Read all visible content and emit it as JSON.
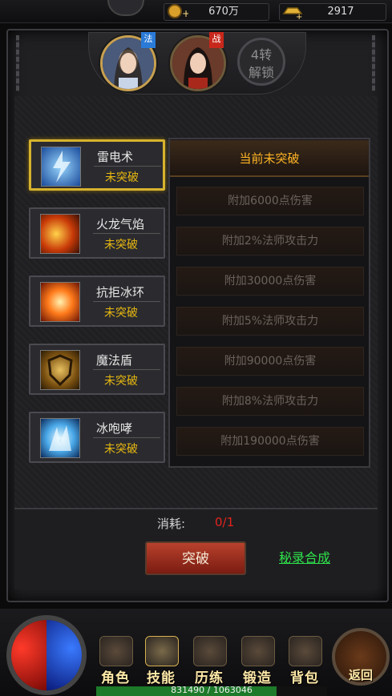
{
  "currency": {
    "gold": {
      "icon": "gold-coin-icon",
      "value": "670万"
    },
    "ingot": {
      "icon": "gold-ingot-icon",
      "value": "2917"
    }
  },
  "portraits": [
    {
      "name": "mage-portrait",
      "badge": "法",
      "badge_color": "#2a7ad8"
    },
    {
      "name": "warrior-portrait",
      "badge": "战",
      "badge_color": "#c8281c"
    }
  ],
  "locked_slot": {
    "line1": "4转",
    "line2": "解锁"
  },
  "skills": [
    {
      "name": "雷电术",
      "status": "未突破",
      "icon": "lightning-skill-icon",
      "selected": true
    },
    {
      "name": "火龙气焰",
      "status": "未突破",
      "icon": "fire-dragon-skill-icon",
      "selected": false
    },
    {
      "name": "抗拒冰环",
      "status": "未突破",
      "icon": "repel-ring-skill-icon",
      "selected": false
    },
    {
      "name": "魔法盾",
      "status": "未突破",
      "icon": "magic-shield-skill-icon",
      "selected": false
    },
    {
      "name": "冰咆哮",
      "status": "未突破",
      "icon": "ice-roar-skill-icon",
      "selected": false
    }
  ],
  "panel": {
    "title": "当前未突破",
    "effects": [
      "附加6000点伤害",
      "附加2%法师攻击力",
      "附加30000点伤害",
      "附加5%法师攻击力",
      "附加90000点伤害",
      "附加8%法师攻击力",
      "附加190000点伤害"
    ]
  },
  "cost": {
    "label": "消耗:",
    "value": "0/1"
  },
  "break_button": "突破",
  "synth_link": "秘录合成",
  "nav": [
    {
      "label": "角色",
      "icon": "character-icon"
    },
    {
      "label": "技能",
      "icon": "skill-book-icon"
    },
    {
      "label": "历练",
      "icon": "training-icon"
    },
    {
      "label": "锻造",
      "icon": "forge-icon"
    },
    {
      "label": "背包",
      "icon": "backpack-icon"
    }
  ],
  "back_button": "返回",
  "exp": {
    "text": "831490 / 1063046",
    "fraction": 0.782
  }
}
